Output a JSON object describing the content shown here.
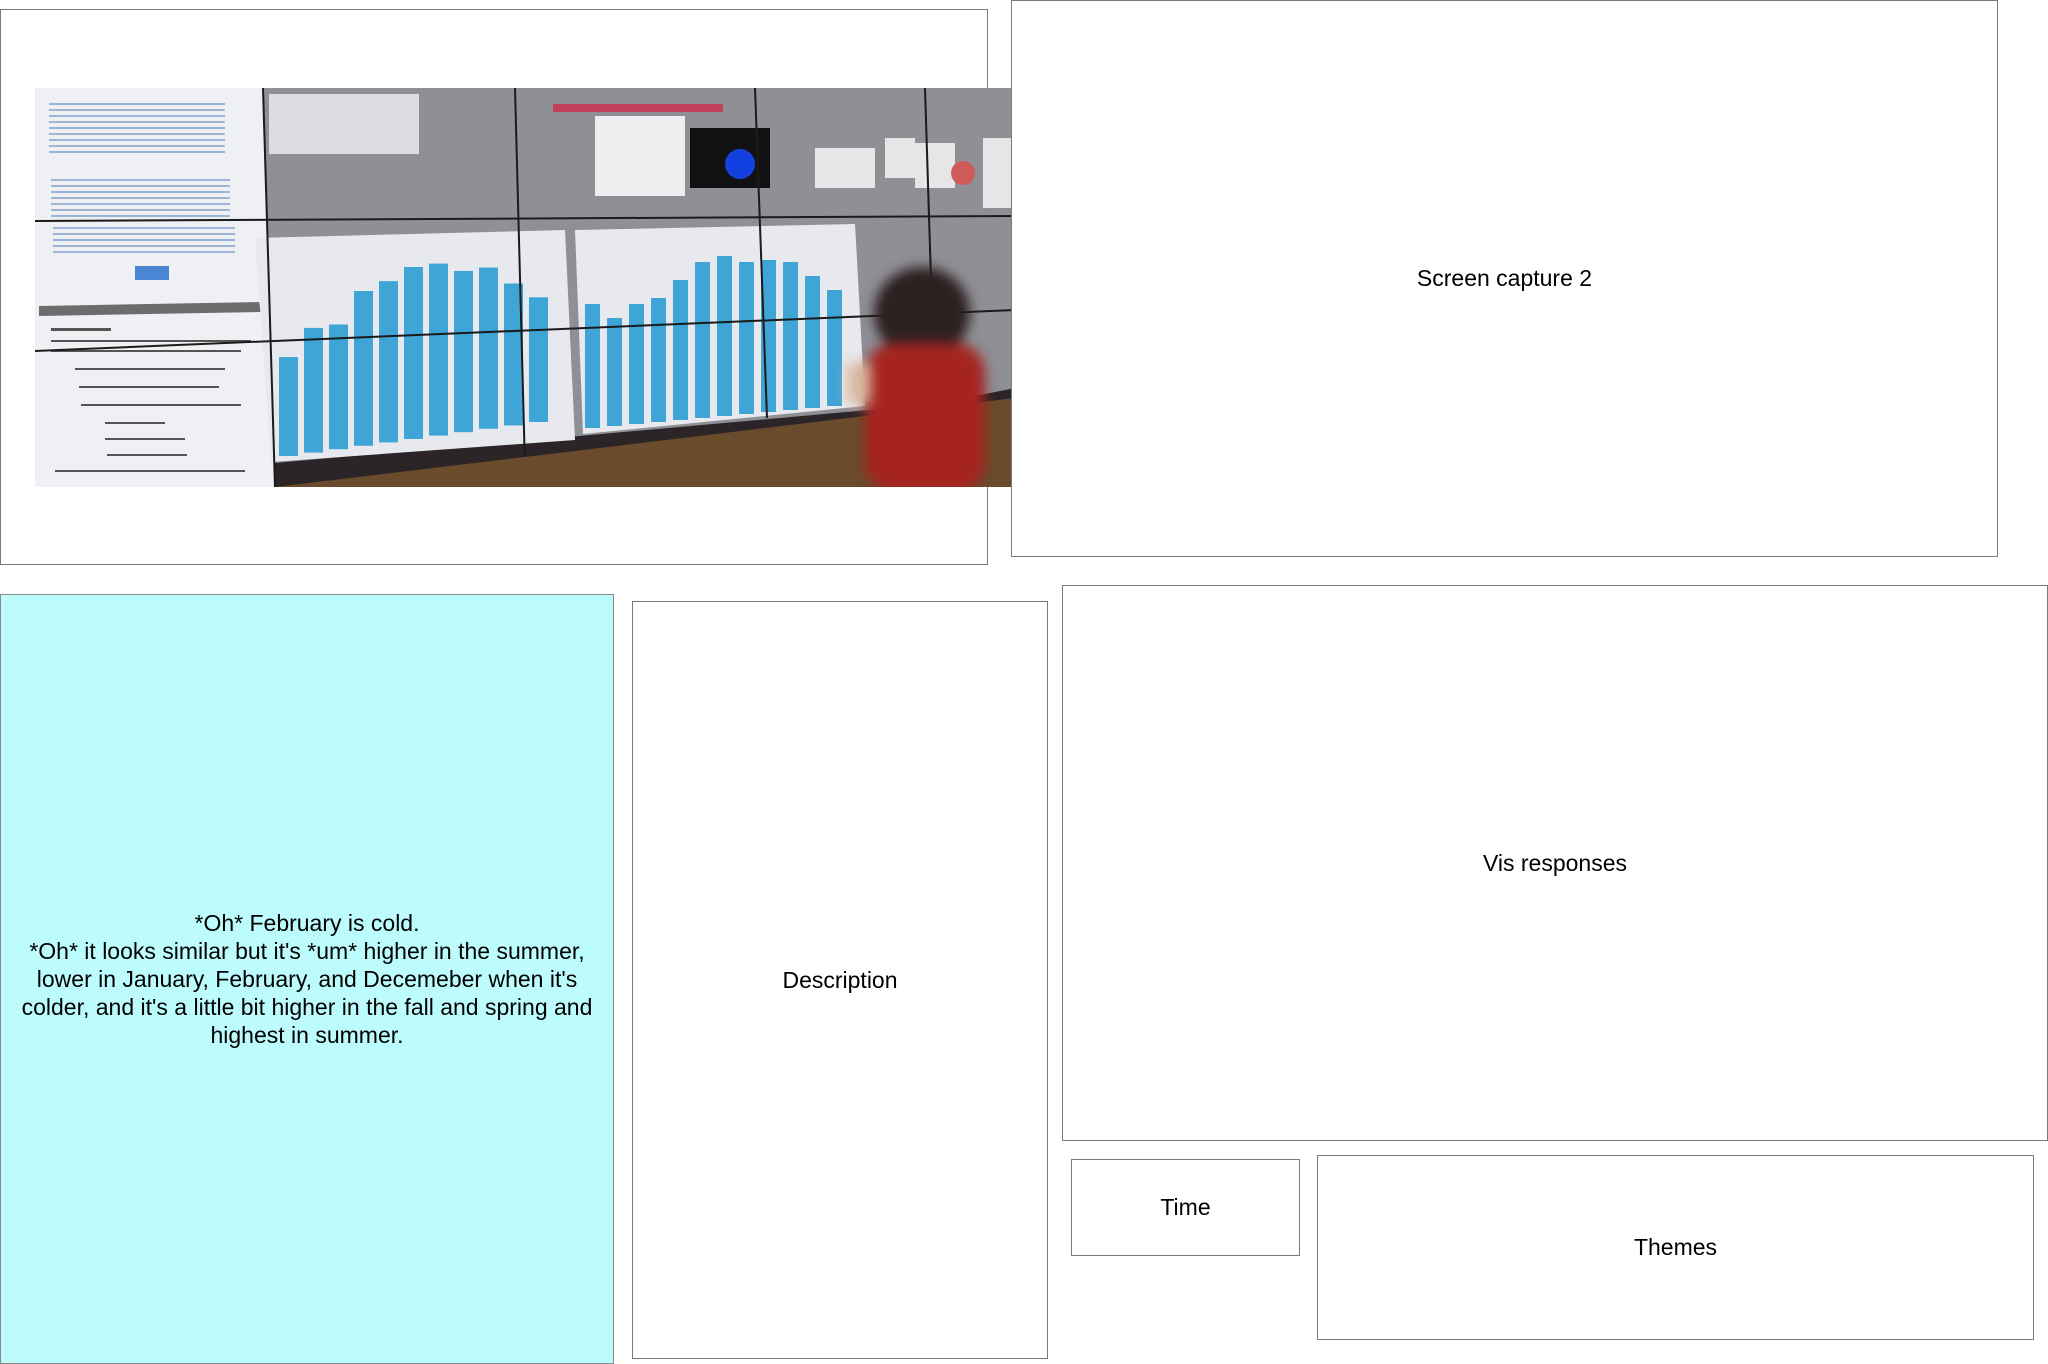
{
  "panels": {
    "capture2_label": "Screen capture 2",
    "transcript_lines": [
      "*Oh* February is cold.",
      "*Oh* it looks similar but it's *um* higher in the summer, lower in January, February, and Decemeber when it's colder, and it's a little bit higher in the fall and spring and highest in summer."
    ],
    "description_label": "Description",
    "vis_label": "Vis responses",
    "time_label": "Time",
    "themes_label": "Themes"
  },
  "colors": {
    "transcript_bg": "#bdfcfc",
    "bar_blue": "#3fa4d6"
  },
  "photo": {
    "bar_values_left": [
      46,
      58,
      58,
      72,
      75,
      80,
      80,
      75,
      75,
      66,
      58
    ],
    "bar_values_right": [
      62,
      54,
      60,
      62,
      70,
      78,
      80,
      76,
      76,
      74,
      66,
      58
    ]
  }
}
